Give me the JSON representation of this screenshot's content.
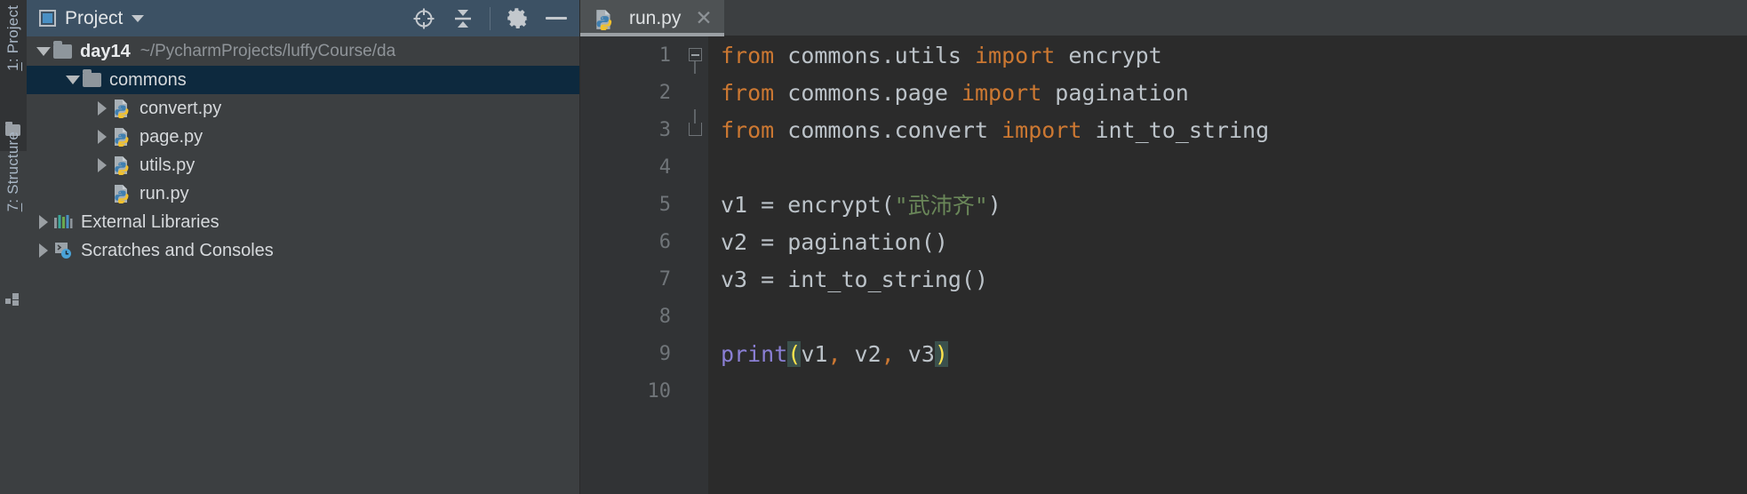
{
  "rail": {
    "project_tool": {
      "num": "1",
      "label": ": Project",
      "icon": "folder-icon"
    },
    "structure_tool": {
      "num": "7",
      "label": ": Structure",
      "icon": "structure-icon"
    }
  },
  "project_panel": {
    "title": "Project",
    "dropdown_icon": "chevron-down-icon",
    "tools": [
      {
        "name": "select-opened-file-icon",
        "glyph": "target-icon"
      },
      {
        "name": "collapse-all-icon",
        "glyph": "collapse-icon"
      },
      {
        "name": "settings-icon",
        "glyph": "gear-icon"
      },
      {
        "name": "hide-icon",
        "glyph": "minimize-icon"
      }
    ],
    "tree": [
      {
        "label": "day14",
        "path": "~/PycharmProjects/luffyCourse/da",
        "icon": "folder-icon",
        "twisty": "expanded",
        "indent": 0,
        "bold": true,
        "selected": false
      },
      {
        "label": "commons",
        "path": "",
        "icon": "folder-icon",
        "twisty": "expanded",
        "indent": 1,
        "bold": false,
        "selected": true
      },
      {
        "label": "convert.py",
        "path": "",
        "icon": "python-file-icon",
        "twisty": "collapsed",
        "indent": 2,
        "bold": false,
        "selected": false
      },
      {
        "label": "page.py",
        "path": "",
        "icon": "python-file-icon",
        "twisty": "collapsed",
        "indent": 2,
        "bold": false,
        "selected": false
      },
      {
        "label": "utils.py",
        "path": "",
        "icon": "python-file-icon",
        "twisty": "collapsed",
        "indent": 2,
        "bold": false,
        "selected": false
      },
      {
        "label": "run.py",
        "path": "",
        "icon": "python-file-icon",
        "twisty": "none",
        "indent": 2,
        "bold": false,
        "selected": false
      },
      {
        "label": "External Libraries",
        "path": "",
        "icon": "libraries-icon",
        "twisty": "collapsed",
        "indent": 0,
        "bold": false,
        "selected": false
      },
      {
        "label": "Scratches and Consoles",
        "path": "",
        "icon": "scratches-icon",
        "twisty": "collapsed",
        "indent": 0,
        "bold": false,
        "selected": false
      }
    ]
  },
  "editor": {
    "tab": {
      "label": "run.py",
      "icon": "python-file-icon",
      "close_icon": "close-icon"
    },
    "line_numbers": [
      "1",
      "2",
      "3",
      "4",
      "5",
      "6",
      "7",
      "8",
      "9",
      "10"
    ],
    "code": [
      {
        "n": "1",
        "fold": "start",
        "tokens": [
          {
            "t": "from",
            "c": "kw"
          },
          {
            "t": " commons.utils ",
            "c": "txt"
          },
          {
            "t": "import",
            "c": "kw"
          },
          {
            "t": " encrypt",
            "c": "txt"
          }
        ]
      },
      {
        "n": "2",
        "fold": "none",
        "tokens": [
          {
            "t": "from",
            "c": "kw"
          },
          {
            "t": " commons.page ",
            "c": "txt"
          },
          {
            "t": "import",
            "c": "kw"
          },
          {
            "t": " pagination",
            "c": "txt"
          }
        ]
      },
      {
        "n": "3",
        "fold": "end",
        "tokens": [
          {
            "t": "from",
            "c": "kw"
          },
          {
            "t": " commons.convert ",
            "c": "txt"
          },
          {
            "t": "import",
            "c": "kw"
          },
          {
            "t": " int_to_string",
            "c": "txt"
          }
        ]
      },
      {
        "n": "4",
        "fold": "none",
        "tokens": []
      },
      {
        "n": "5",
        "fold": "none",
        "tokens": [
          {
            "t": "v1 = encrypt(",
            "c": "txt"
          },
          {
            "t": "\"武沛齐\"",
            "c": "str"
          },
          {
            "t": ")",
            "c": "txt"
          }
        ]
      },
      {
        "n": "6",
        "fold": "none",
        "tokens": [
          {
            "t": "v2 = pagination()",
            "c": "txt"
          }
        ]
      },
      {
        "n": "7",
        "fold": "none",
        "tokens": [
          {
            "t": "v3 = int_to_string()",
            "c": "txt"
          }
        ]
      },
      {
        "n": "8",
        "fold": "none",
        "tokens": []
      },
      {
        "n": "9",
        "fold": "none",
        "tokens": [
          {
            "t": "print",
            "c": "blt"
          },
          {
            "t": "(",
            "c": "punc-hl"
          },
          {
            "t": "v1",
            "c": "txt"
          },
          {
            "t": ",",
            "c": "comma"
          },
          {
            "t": " v2",
            "c": "txt"
          },
          {
            "t": ",",
            "c": "comma"
          },
          {
            "t": " v3",
            "c": "txt"
          },
          {
            "t": ")",
            "c": "punc-hl"
          }
        ]
      },
      {
        "n": "10",
        "fold": "none",
        "tokens": []
      }
    ]
  },
  "colors": {
    "panel_header_bg": "#3c5164",
    "panel_bg": "#3c3f41",
    "selection_bg": "#0d293e",
    "editor_bg": "#2b2b2b",
    "gutter_bg": "#313335",
    "keyword": "#cc7832",
    "string": "#6a8759",
    "builtin": "#8a7fd4",
    "text": "#bcc3c9",
    "bracket_highlight_bg": "#3b514d",
    "bracket_highlight_fg": "#ffe44c"
  }
}
